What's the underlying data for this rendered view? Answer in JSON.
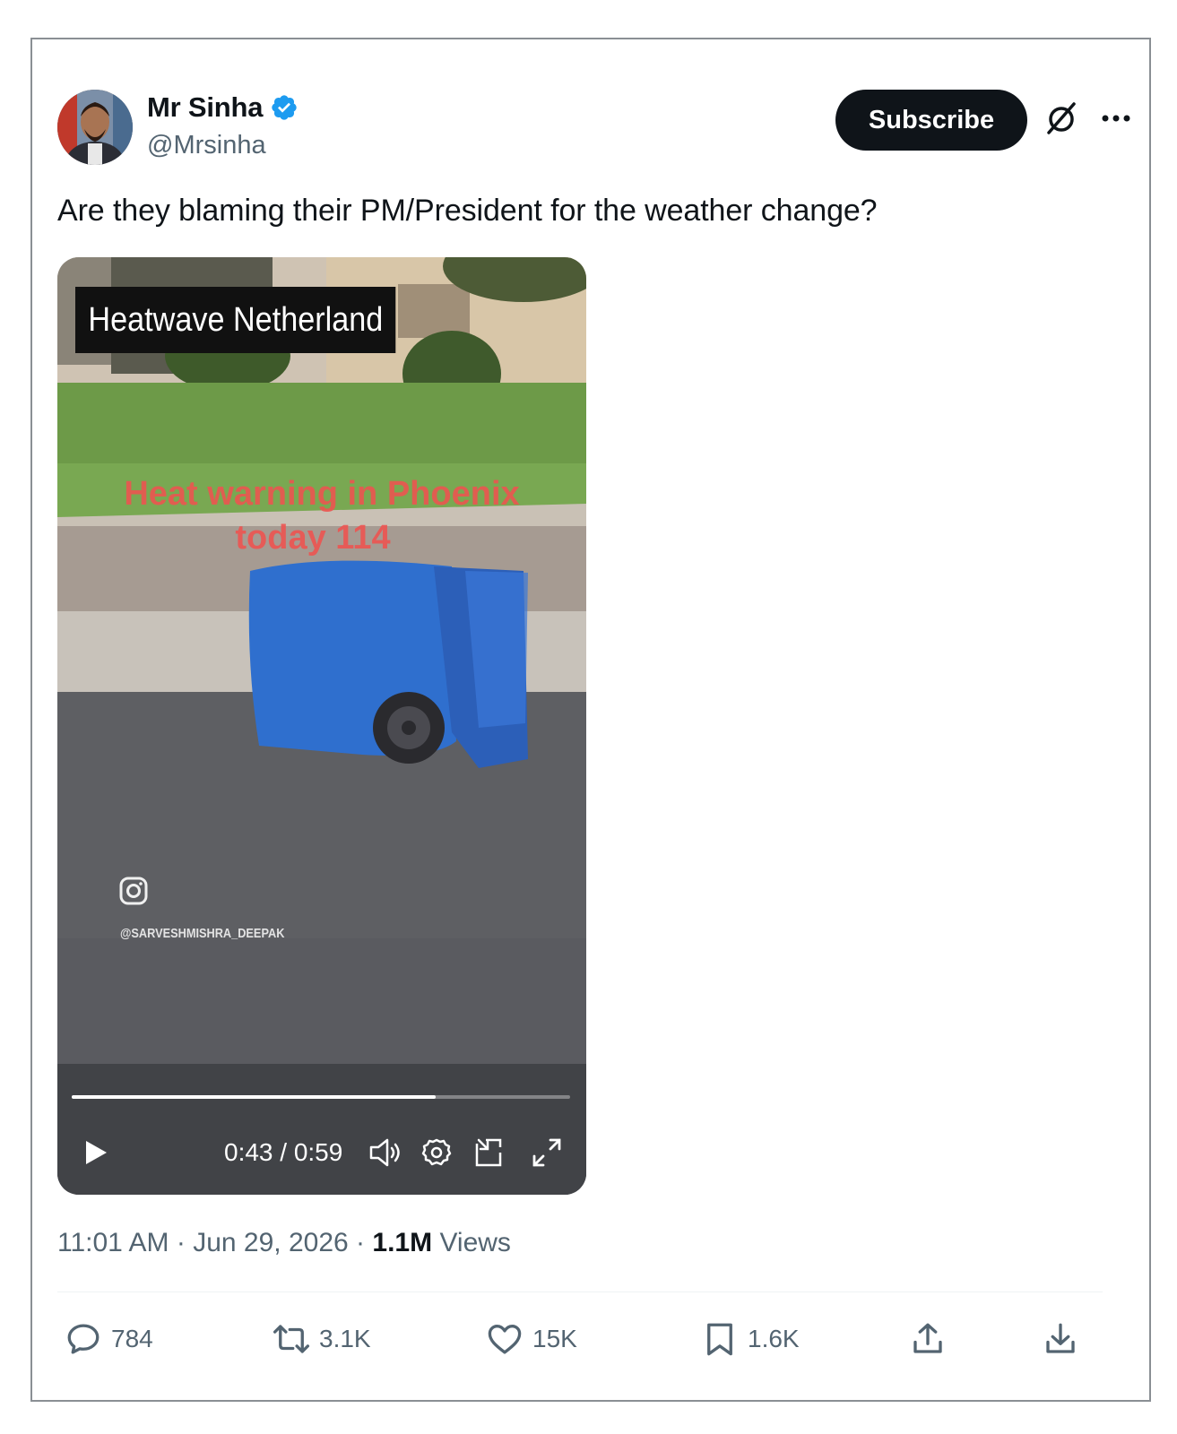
{
  "author": {
    "display_name": "Mr Sinha",
    "handle": "@Mrsinha",
    "verified": true,
    "verified_color": "#1d9bf0"
  },
  "header": {
    "subscribe_label": "Subscribe",
    "icons": [
      "grok-icon",
      "more-icon"
    ]
  },
  "tweet": {
    "text": "Are they blaming their PM/President for the weather change?"
  },
  "video": {
    "overlay_title": "Heatwave Netherland",
    "overlay_red_line1": "Heat warning in Phoenix",
    "overlay_red_line2": "today 114",
    "watermark": "@SARVESHMISHRA_DEEPAK",
    "time": "0:43 / 0:59",
    "progress": 0.73,
    "controls": [
      "play-icon",
      "volume-icon",
      "settings-icon",
      "pip-icon",
      "fullscreen-icon"
    ]
  },
  "meta": {
    "time": "11:01 AM",
    "date": "Jun 29, 2026",
    "views_count": "1.1M",
    "views_label": "Views",
    "separator": "·"
  },
  "actions": {
    "replies": "784",
    "reposts": "3.1K",
    "likes": "15K",
    "bookmarks": "1.6K"
  },
  "colors": {
    "text_primary": "#0f1419",
    "text_secondary": "#536471",
    "subscribe_bg": "#0f1419",
    "overlay_red": "#ef5350"
  }
}
